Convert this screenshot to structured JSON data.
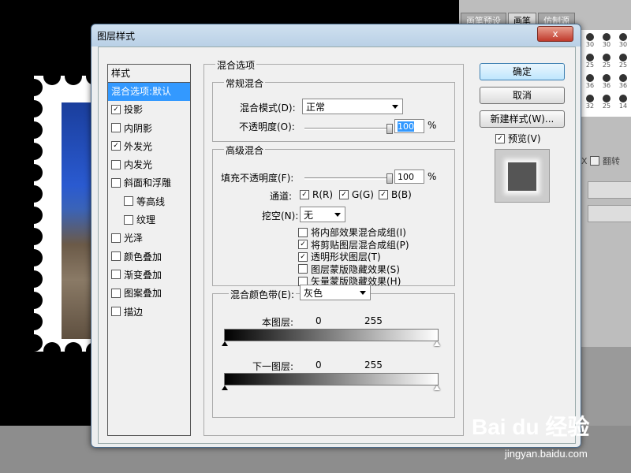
{
  "dialog": {
    "title": "图层样式",
    "close_label": "x"
  },
  "style_list": {
    "header": "样式",
    "items": [
      {
        "label": "混合选项:默认",
        "checkbox": false,
        "checked": false,
        "active": true,
        "sub": false
      },
      {
        "label": "投影",
        "checkbox": true,
        "checked": true,
        "active": false,
        "sub": false
      },
      {
        "label": "内阴影",
        "checkbox": true,
        "checked": false,
        "active": false,
        "sub": false
      },
      {
        "label": "外发光",
        "checkbox": true,
        "checked": true,
        "active": false,
        "sub": false
      },
      {
        "label": "内发光",
        "checkbox": true,
        "checked": false,
        "active": false,
        "sub": false
      },
      {
        "label": "斜面和浮雕",
        "checkbox": true,
        "checked": false,
        "active": false,
        "sub": false
      },
      {
        "label": "等高线",
        "checkbox": true,
        "checked": false,
        "active": false,
        "sub": true
      },
      {
        "label": "纹理",
        "checkbox": true,
        "checked": false,
        "active": false,
        "sub": true
      },
      {
        "label": "光泽",
        "checkbox": true,
        "checked": false,
        "active": false,
        "sub": false
      },
      {
        "label": "颜色叠加",
        "checkbox": true,
        "checked": false,
        "active": false,
        "sub": false
      },
      {
        "label": "渐变叠加",
        "checkbox": true,
        "checked": false,
        "active": false,
        "sub": false
      },
      {
        "label": "图案叠加",
        "checkbox": true,
        "checked": false,
        "active": false,
        "sub": false
      },
      {
        "label": "描边",
        "checkbox": true,
        "checked": false,
        "active": false,
        "sub": false
      }
    ]
  },
  "blend_options": {
    "title": "混合选项",
    "general": {
      "title": "常规混合",
      "blend_mode_label": "混合模式(D):",
      "blend_mode_value": "正常",
      "opacity_label": "不透明度(O):",
      "opacity_value": "100",
      "opacity_fraction": 1.0,
      "percent": "%"
    },
    "advanced": {
      "title": "高级混合",
      "fill_opacity_label": "填充不透明度(F):",
      "fill_opacity_value": "100",
      "fill_fraction": 1.0,
      "percent": "%",
      "channels_label": "通道:",
      "channel_r": "R(R)",
      "channel_g": "G(G)",
      "channel_b": "B(B)",
      "knockout_label": "挖空(N):",
      "knockout_value": "无",
      "options": [
        {
          "label": "将内部效果混合成组(I)",
          "checked": false
        },
        {
          "label": "将剪贴图层混合成组(P)",
          "checked": true
        },
        {
          "label": "透明形状图层(T)",
          "checked": true
        },
        {
          "label": "图层蒙版隐藏效果(S)",
          "checked": false
        },
        {
          "label": "矢量蒙版隐藏效果(H)",
          "checked": false
        }
      ]
    },
    "blend_if": {
      "label": "混合颜色带(E):",
      "value": "灰色",
      "this_layer_label": "本图层:",
      "this_layer_min": "0",
      "this_layer_max": "255",
      "under_layer_label": "下一图层:",
      "under_layer_min": "0",
      "under_layer_max": "255"
    }
  },
  "buttons": {
    "ok": "确定",
    "cancel": "取消",
    "new_style": "新建样式(W)...",
    "preview": "预览(V)"
  },
  "background": {
    "brush_tabs": [
      "画笔预设",
      "画笔",
      "仿制源"
    ],
    "brush_sizes": [
      "30",
      "30",
      "30",
      "25",
      "25",
      "25",
      "36",
      "36",
      "36",
      "32",
      "25",
      "14"
    ],
    "flip_label": "翻转",
    "x_label": "X"
  },
  "watermark": {
    "brand": "Bai du 经验",
    "url": "jingyan.baidu.com"
  }
}
